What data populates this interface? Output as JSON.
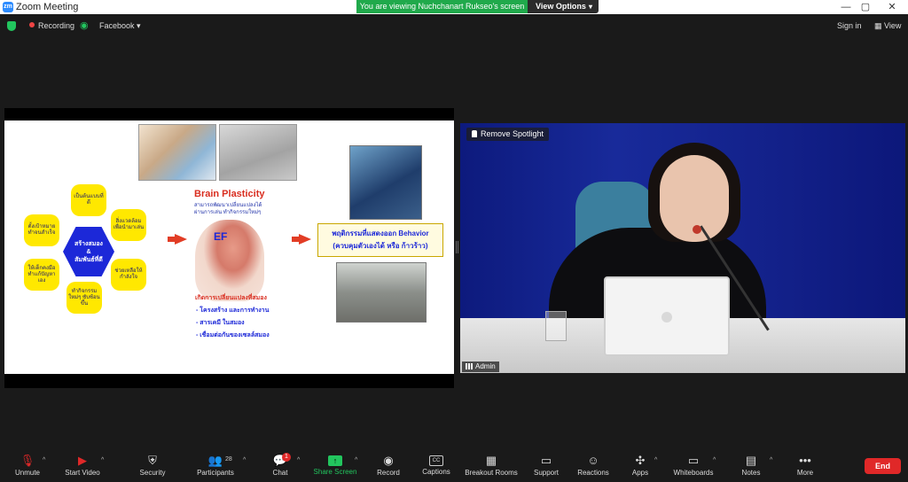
{
  "window": {
    "app_title": "Zoom Meeting",
    "app_icon": "zoom-icon",
    "share_banner": "You are viewing Nuchchanart Rukseo's screen",
    "view_options": "View Options",
    "controls": [
      "—",
      "▢",
      "✕"
    ]
  },
  "topbar": {
    "recording": "Recording",
    "live_stream": "Facebook",
    "sign_in": "Sign in",
    "view": "View"
  },
  "slide": {
    "brain_plasticity_title": "Brain Plasticity",
    "brain_plasticity_sub": [
      "สามารถพัฒนาเปลี่ยนแปลงได้",
      "ผ่านการเล่น ทำกิจกรรมใหม่ๆ"
    ],
    "ef_label": "EF",
    "hex_center": [
      "สร้างสมอง",
      "&",
      "สัมพันธ์ที่ดี"
    ],
    "hex_items": [
      "เป็นต้นแบบที่ดี",
      "สิ่งแวดล้อมเพื่อนำมาเล่น",
      "ช่วยเหลือให้กำลังใจ",
      "ทำกิจกรรมใหม่ๆ ซับซ้อนขึ้น",
      "ให้เด็กคงมือทำแก้ปัญหาเอง",
      "ตั้งเป้าหมายทำจนสำเร็จ"
    ],
    "change_title": "เกิดการเปลี่ยนแปลงที่สมอง",
    "change_items": [
      "- โครงสร้าง และการทำงาน",
      "- สารเคมี ในสมอง",
      "- เชื่อมต่อกันของเซลล์สมอง"
    ],
    "behavior_line1": "พฤติกรรมที่แสดงออก Behavior",
    "behavior_line2": "(ควบคุมตัวเองได้ หรือ ก้าวร้าว)"
  },
  "video": {
    "remove_spotlight": "Remove Spotlight",
    "participant_name": "Admin"
  },
  "toolbar": {
    "unmute": "Unmute",
    "start_video": "Start Video",
    "security": "Security",
    "participants": "Participants",
    "participants_count": "28",
    "chat": "Chat",
    "chat_badge": "1",
    "share_screen": "Share Screen",
    "record": "Record",
    "captions": "Captions",
    "captions_icon_text": "CC",
    "breakout_rooms": "Breakout Rooms",
    "support": "Support",
    "reactions": "Reactions",
    "apps": "Apps",
    "whiteboards": "Whiteboards",
    "notes": "Notes",
    "more": "More",
    "end": "End"
  }
}
